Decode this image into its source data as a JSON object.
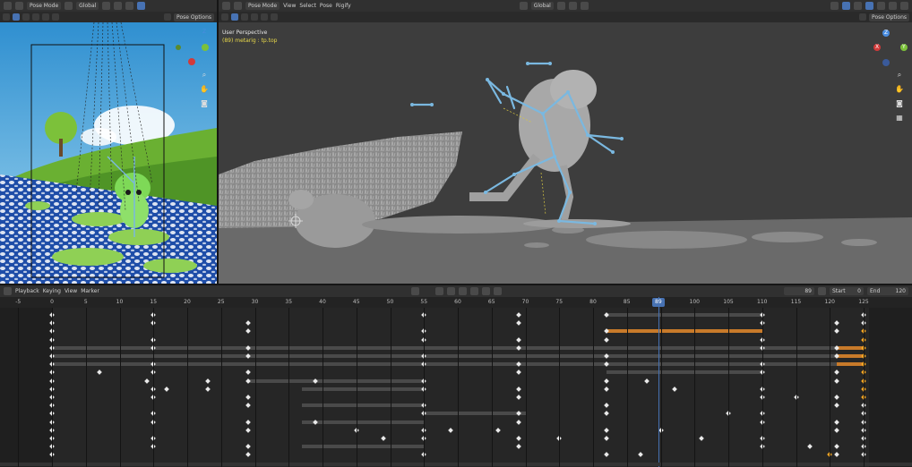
{
  "left_view": {
    "mode": "Pose Mode",
    "orientation": "Global",
    "options": "Pose Options"
  },
  "main_view": {
    "mode": "Pose Mode",
    "menu": [
      "View",
      "Select",
      "Pose",
      "Rigify"
    ],
    "orientation": "Global",
    "options": "Pose Options",
    "overlay_title": "User Perspective",
    "overlay_subtitle": "(89) metarig : tp.top"
  },
  "axis_gizmo": {
    "z": "Z",
    "y": "Y",
    "x": "X"
  },
  "timeline": {
    "menu": [
      "Playback",
      "Keying",
      "View",
      "Marker"
    ],
    "current_frame": "89",
    "start_label": "Start",
    "start_value": "0",
    "end_label": "End",
    "end_value": "120",
    "ruler_ticks": [
      "-5",
      "0",
      "5",
      "10",
      "15",
      "20",
      "25",
      "30",
      "35",
      "40",
      "45",
      "50",
      "55",
      "60",
      "65",
      "70",
      "75",
      "80",
      "85",
      "89",
      "100",
      "105",
      "110",
      "115",
      "120",
      "125"
    ]
  },
  "colors": {
    "accent_blue": "#4772b3",
    "keyframe": "#e9e9e9",
    "selected_keyframe": "#f5a623",
    "bone": "#7ab8e0"
  }
}
